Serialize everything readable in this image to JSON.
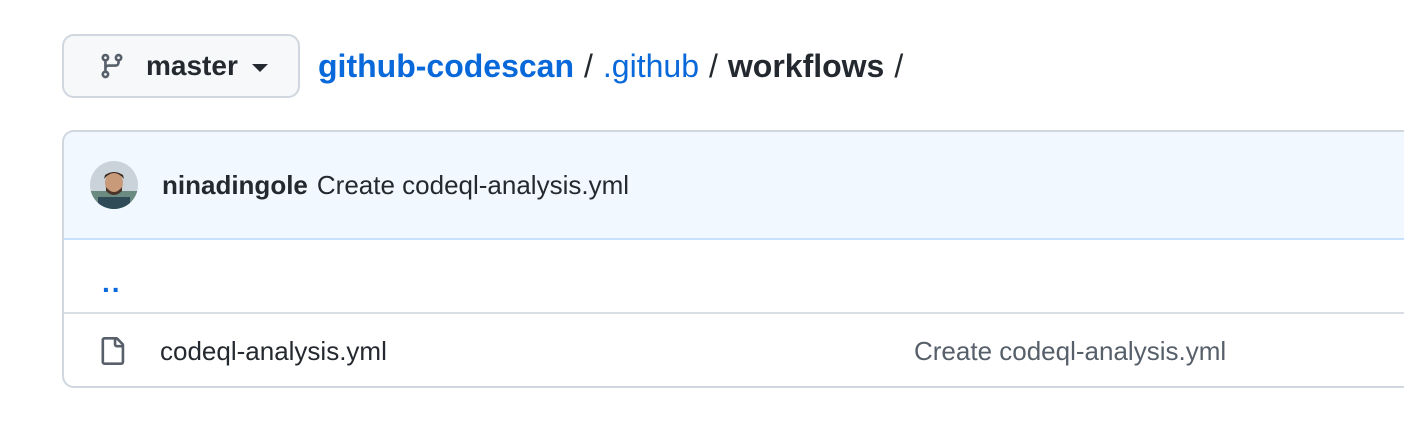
{
  "branch": {
    "name": "master",
    "icon": "git-branch-icon"
  },
  "breadcrumb": {
    "repo": "github-codescan",
    "sep1": "/",
    "folder1": ".github",
    "sep2": "/",
    "current": "workflows",
    "sep3": "/"
  },
  "latest_commit": {
    "author": "ninadingole",
    "message": "Create codeql-analysis.yml"
  },
  "parent_dir": {
    "label": ".."
  },
  "files": [
    {
      "name": "codeql-analysis.yml",
      "commit_message": "Create codeql-analysis.yml",
      "icon": "file-icon"
    }
  ],
  "colors": {
    "link": "#0969da",
    "header_bg": "#f1f8ff",
    "border": "#d0d7de",
    "muted": "#57606a"
  }
}
